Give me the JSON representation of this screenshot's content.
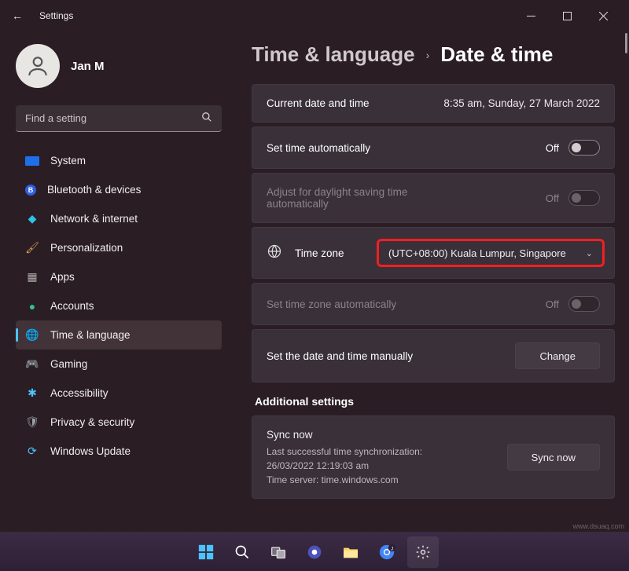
{
  "window": {
    "title": "Settings"
  },
  "user": {
    "name": "Jan M"
  },
  "search": {
    "placeholder": "Find a setting"
  },
  "sidebar": {
    "items": [
      {
        "label": "System",
        "icon": "🖥️",
        "color": "#4cc2ff"
      },
      {
        "label": "Bluetooth & devices",
        "icon": "B",
        "color": "#3a8ee6"
      },
      {
        "label": "Network & internet",
        "icon": "📶",
        "color": "#2ec4e6"
      },
      {
        "label": "Personalization",
        "icon": "🖌️",
        "color": "#e08f3a"
      },
      {
        "label": "Apps",
        "icon": "▦",
        "color": "#8e8a88"
      },
      {
        "label": "Accounts",
        "icon": "👤",
        "color": "#2fc28a"
      },
      {
        "label": "Time & language",
        "icon": "🌐",
        "color": "#4cc2ff",
        "active": true
      },
      {
        "label": "Gaming",
        "icon": "🎮",
        "color": "#a0a0a0"
      },
      {
        "label": "Accessibility",
        "icon": "✱",
        "color": "#4cc2ff"
      },
      {
        "label": "Privacy & security",
        "icon": "🛡️",
        "color": "#9aa0a6"
      },
      {
        "label": "Windows Update",
        "icon": "🔄",
        "color": "#4cc2ff"
      }
    ]
  },
  "breadcrumb": {
    "parent": "Time & language",
    "current": "Date & time"
  },
  "settings": {
    "current_dt_label": "Current date and time",
    "current_dt_value": "8:35 am, Sunday, 27 March 2022",
    "auto_time_label": "Set time automatically",
    "auto_time_state": "Off",
    "dst_label": "Adjust for daylight saving time automatically",
    "dst_state": "Off",
    "tz_label": "Time zone",
    "tz_value": "(UTC+08:00) Kuala Lumpur, Singapore",
    "auto_tz_label": "Set time zone automatically",
    "auto_tz_state": "Off",
    "manual_label": "Set the date and time manually",
    "manual_button": "Change",
    "additional_heading": "Additional settings",
    "sync_title": "Sync now",
    "sync_line1": "Last successful time synchronization:",
    "sync_line2": "26/03/2022 12:19:03 am",
    "sync_line3": "Time server: time.windows.com",
    "sync_button": "Sync now"
  }
}
